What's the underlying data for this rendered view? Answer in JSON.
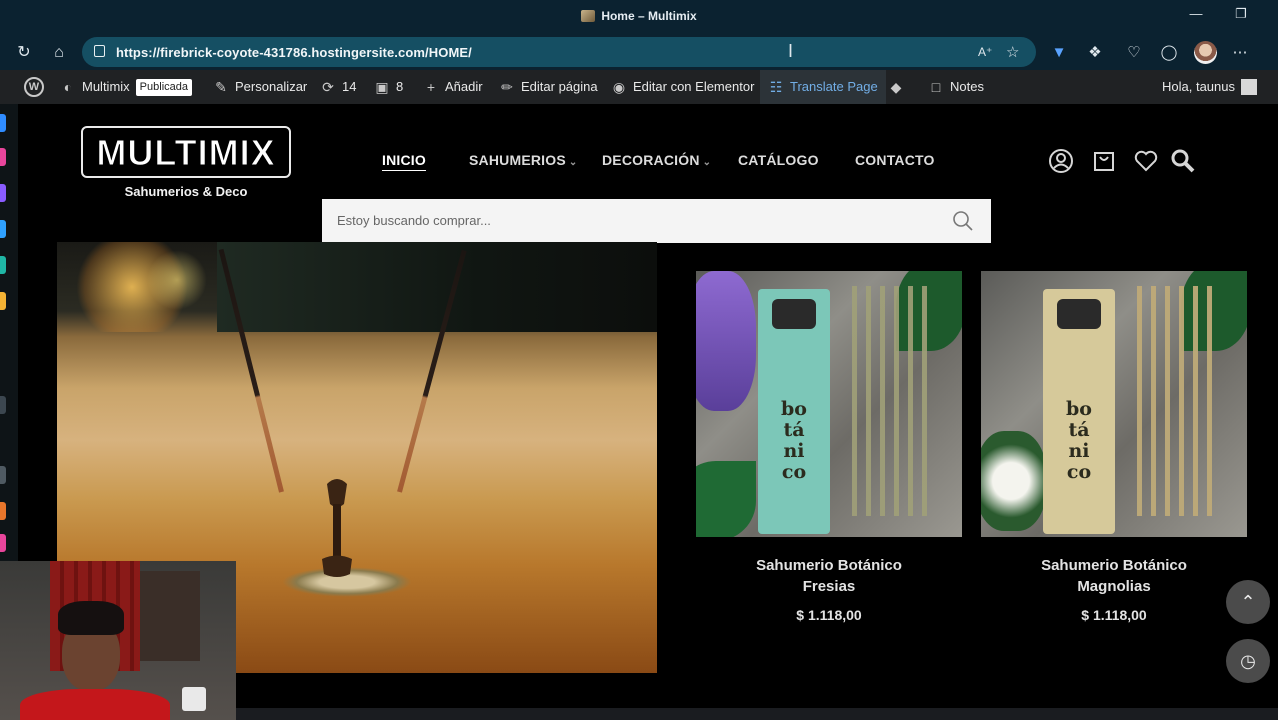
{
  "browser": {
    "window_title": "Home – Multimix",
    "url": "https://firebrick-coyote-431786.hostingersite.com/HOME/"
  },
  "admin_bar": {
    "site_name": "Multimix",
    "status_badge": "Publicada",
    "customize": "Personalizar",
    "updates_count": "14",
    "comments_count": "8",
    "add_new": "Añadir",
    "edit_page": "Editar página",
    "edit_elementor": "Editar con Elementor",
    "translate": "Translate Page",
    "notes": "Notes",
    "greeting": "Hola, taunus"
  },
  "site": {
    "logo_text": "MULTIMIX",
    "logo_tagline": "Sahumerios & Deco",
    "nav": [
      {
        "label": "INICIO",
        "active": true,
        "dropdown": false
      },
      {
        "label": "SAHUMERIOS",
        "active": false,
        "dropdown": true
      },
      {
        "label": "DECORACIÓN",
        "active": false,
        "dropdown": true
      },
      {
        "label": "CATÁLOGO",
        "active": false,
        "dropdown": false
      },
      {
        "label": "CONTACTO",
        "active": false,
        "dropdown": false
      }
    ],
    "search_placeholder": "Estoy buscando comprar..."
  },
  "products": [
    {
      "name_line1": "Sahumerio Botánico",
      "name_line2": "Fresias",
      "price": "$ 1.118,00",
      "box_text": "bo\ntá\nni\nco",
      "box_color": "#7cc7b8"
    },
    {
      "name_line1": "Sahumerio Botánico",
      "name_line2": "Magnolias",
      "price": "$ 1.118,00",
      "box_text": "bo\ntá\nni\nco",
      "box_color": "#d6c99a"
    }
  ],
  "colors": {
    "browser_chrome": "#0b2230",
    "url_box": "#154f63",
    "admin_bar": "#202224",
    "site_bg": "#000000"
  }
}
